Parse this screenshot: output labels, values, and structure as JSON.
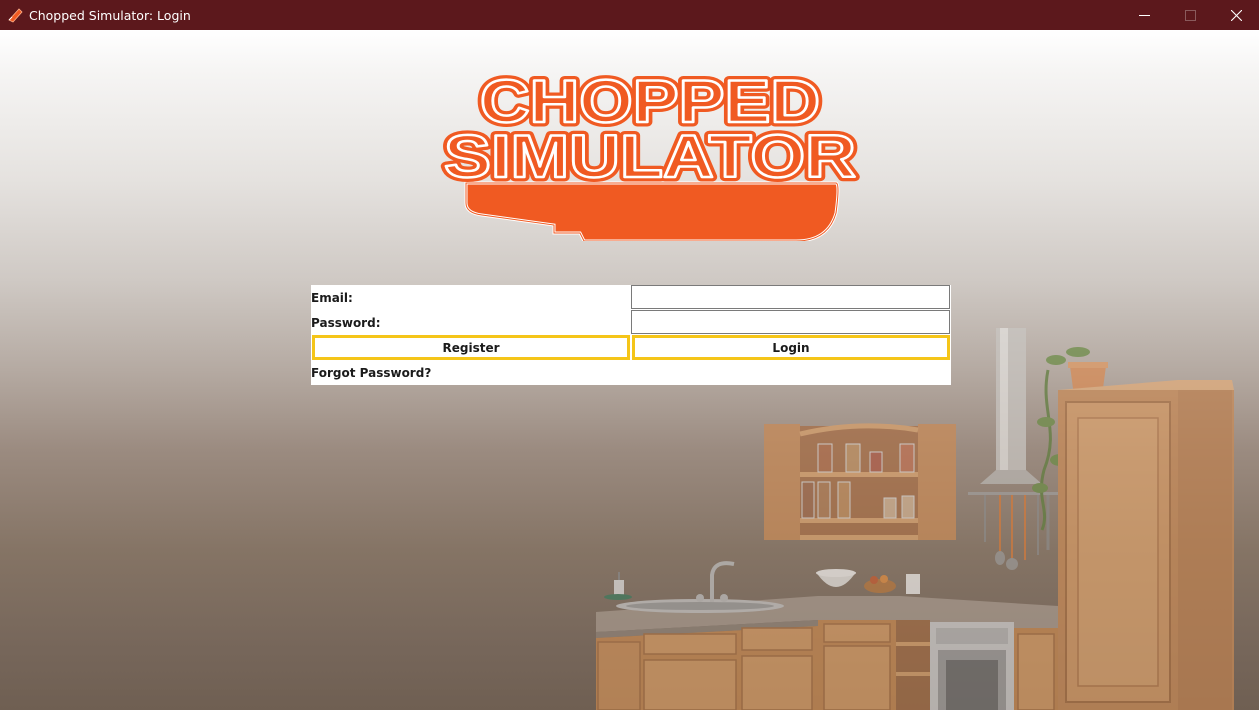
{
  "window": {
    "title": "Chopped Simulator: Login",
    "titlebar_color": "#5c181c",
    "controls": [
      "minimize-icon",
      "maximize-icon",
      "close-icon"
    ]
  },
  "logo": {
    "line1": "CHOPPED",
    "line2": "SIMULATOR",
    "color": "#f05a22"
  },
  "login_form": {
    "email_label": "Email:",
    "email_value": "",
    "password_label": "Password:",
    "password_value": "",
    "register_label": "Register",
    "login_label": "Login",
    "forgot_label": "Forgot Password?",
    "button_border_color": "#f5c518"
  }
}
